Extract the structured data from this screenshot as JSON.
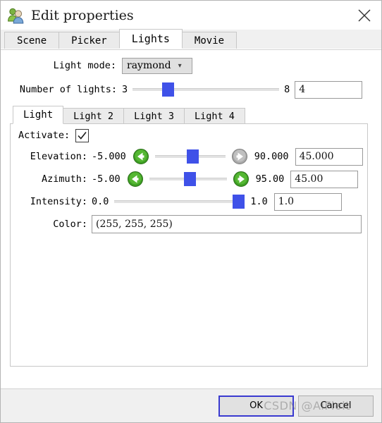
{
  "window": {
    "title": "Edit properties",
    "icon": "users-icon",
    "close_icon": "close-icon"
  },
  "tabs": [
    {
      "label": "Scene",
      "active": false
    },
    {
      "label": "Picker",
      "active": false
    },
    {
      "label": "Lights",
      "active": true
    },
    {
      "label": "Movie",
      "active": false
    }
  ],
  "light_mode": {
    "label": "Light mode:",
    "value": "raymond",
    "caret_icon": "chevron-down-icon"
  },
  "number_of_lights": {
    "label": "Number of lights:",
    "min": "3",
    "max": "8",
    "value": "4",
    "thumb_pct": 20
  },
  "light_tabs": [
    {
      "label": "Light",
      "active": true
    },
    {
      "label": "Light 2",
      "active": false
    },
    {
      "label": "Light 3",
      "active": false
    },
    {
      "label": "Light 4",
      "active": false
    }
  ],
  "activate": {
    "label": "Activate:",
    "checked": true,
    "check_icon": "checkmark-icon"
  },
  "params": [
    {
      "name": "elevation",
      "label": "Elevation:",
      "min": "-5.000",
      "max": "90.000",
      "value": "45.000",
      "thumb_pct": 52,
      "left_arrow_icon": "arrow-left-circle-icon",
      "right_arrow_icon": "arrow-right-circle-icon",
      "left_arrow_color": "#3d9e23",
      "right_arrow_color": "#a8a8a8"
    },
    {
      "name": "azimuth",
      "label": "Azimuth:",
      "min": "-5.00",
      "max": "95.00",
      "value": "45.00",
      "thumb_pct": 50,
      "left_arrow_icon": "arrow-left-circle-icon",
      "right_arrow_icon": "arrow-right-circle-icon",
      "left_arrow_color": "#3d9e23",
      "right_arrow_color": "#3d9e23"
    }
  ],
  "intensity": {
    "label": "Intensity:",
    "min": "0.0",
    "max": "1.0",
    "value": "1.0",
    "thumb_pct": 100
  },
  "color": {
    "label": "Color:",
    "value": "(255, 255, 255)"
  },
  "footer": {
    "ok_label": "OK",
    "cancel_label": "Cancel",
    "watermark": "CSDN @AiFlolt"
  },
  "colors": {
    "accent": "#3f51e8",
    "focus_border": "#3a3ad0",
    "green_arrow": "#3d9e23",
    "gray_arrow": "#a8a8a8",
    "window_bg": "#f0f0f0",
    "panel_bg": "#ffffff"
  }
}
